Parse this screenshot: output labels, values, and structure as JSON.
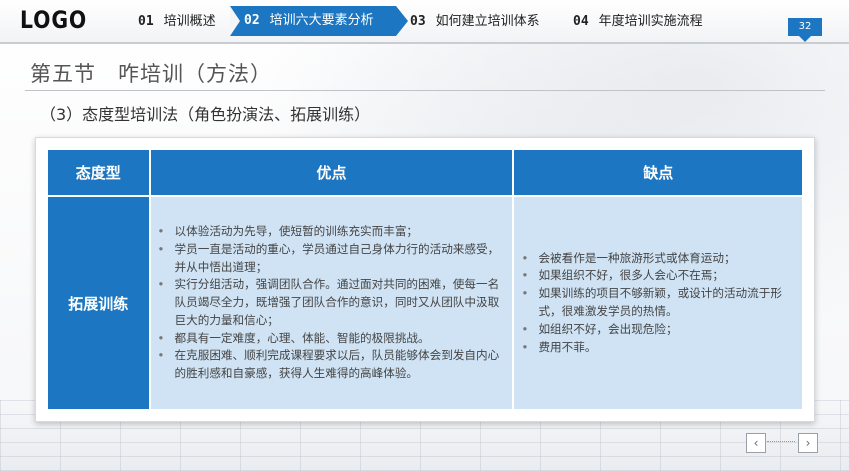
{
  "header": {
    "logo": "LOGO",
    "nav": [
      {
        "num": "01",
        "label": "培训概述"
      },
      {
        "num": "02",
        "label": "培训六大要素分析"
      },
      {
        "num": "03",
        "label": "如何建立培训体系"
      },
      {
        "num": "04",
        "label": "年度培训实施流程"
      }
    ],
    "page_number": "32"
  },
  "section_title": "第五节　咋培训（方法）",
  "subtitle": "（3）态度型培训法（角色扮演法、拓展训练）",
  "table": {
    "headers": [
      "态度型",
      "优点",
      "缺点"
    ],
    "row_header": "拓展训练",
    "pros": [
      "以体验活动为先导，使短暂的训练充实而丰富；",
      "学员一直是活动的重心，学员通过自己身体力行的活动来感受，并从中悟出道理；",
      "实行分组活动，强调团队合作。通过面对共同的困难，使每一名队员竭尽全力，既增强了团队合作的意识，同时又从团队中汲取巨大的力量和信心；",
      "都具有一定难度，心理、体能、智能的极限挑战。",
      "在克服困难、顺利完成课程要求以后，队员能够体会到发自内心的胜利感和自豪感，获得人生难得的高峰体验。"
    ],
    "cons": [
      "会被看作是一种旅游形式或体育运动；",
      "如果组织不好，很多人会心不在焉；",
      "如果训练的项目不够新颖，或设计的活动流于形式，很难激发学员的热情。",
      "如组织不好，会出现危险；",
      "费用不菲。"
    ]
  },
  "footer": {
    "prev_icon": "chevron-left-icon",
    "next_icon": "chevron-right-icon"
  },
  "colors": {
    "accent": "#1c76c1",
    "cell_bg": "#cfe3f4"
  }
}
